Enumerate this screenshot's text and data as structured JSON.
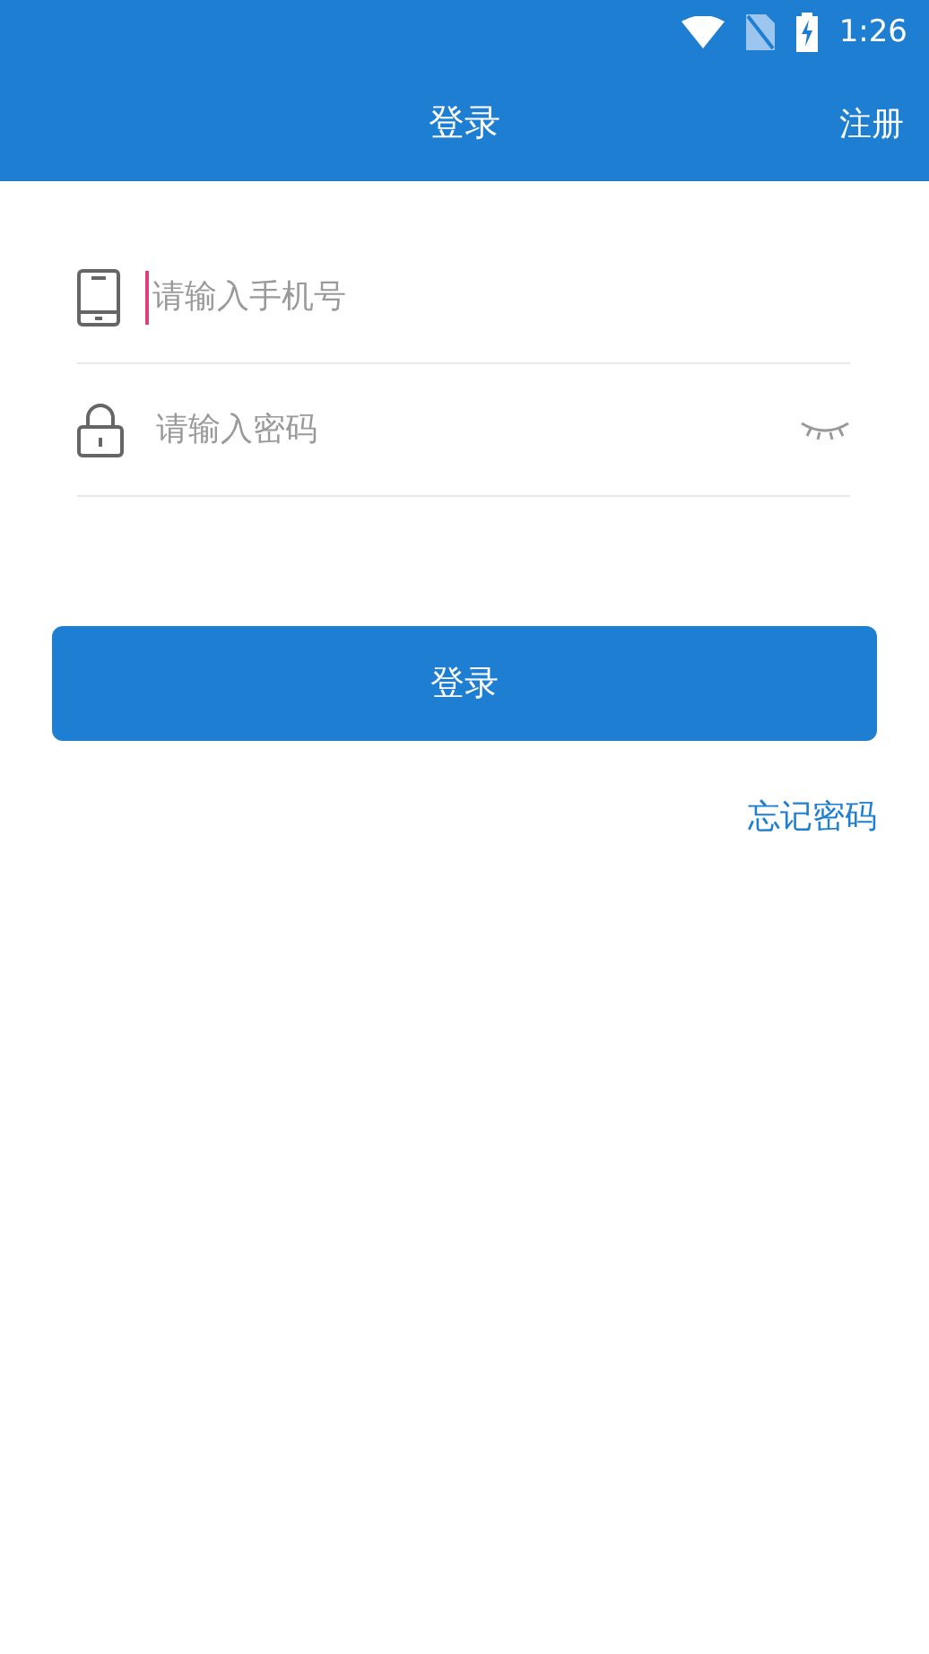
{
  "status_bar": {
    "time": "1:26"
  },
  "app_bar": {
    "title": "登录",
    "action": "注册"
  },
  "fields": [
    {
      "kind": "phone",
      "placeholder": "请输入手机号",
      "focused": true
    },
    {
      "kind": "password",
      "placeholder": "请输入密码",
      "focused": false
    }
  ],
  "login_button": "登录",
  "forgot_link": "忘记密码"
}
